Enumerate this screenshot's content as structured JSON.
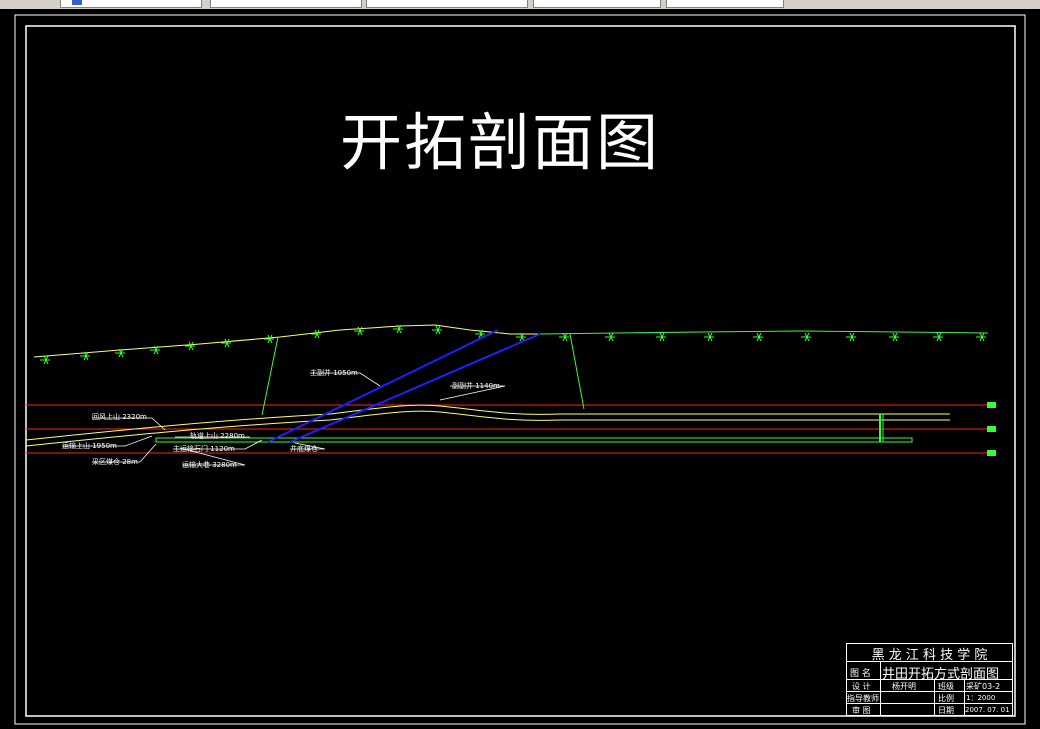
{
  "drawing": {
    "title": "开拓剖面图",
    "colors": {
      "background": "#000000",
      "border": "#ffffff",
      "surface": "#33ff33",
      "seam": "#ffff66",
      "shaft": "#1f1fff",
      "level": "#ff2020",
      "roadway": "#33ff33"
    },
    "labels": {
      "main_shaft": "主副井 1050m",
      "aux_shaft": "副副井 1140m",
      "return_uphill": "回风上山 2320m",
      "track_uphill": "轨道上山 2280m",
      "haul_uphill": "运输上山 1950m",
      "main_crosscut": "主运输石门 1120m",
      "mining_bunker": "采区煤仓 28m",
      "haul_roadway": "运输大巷 3280m",
      "shaft_bunker": "井底煤仓"
    }
  },
  "title_block": {
    "institution": "黑 龙 江 科 技 学 院",
    "drawing_name_label": "图 名",
    "drawing_name": "井田开拓方式剖面图",
    "design_label": "设 计",
    "designer": "杨开明",
    "class_label": "班级",
    "class_value": "采矿03-2",
    "advisor_label": "指导教师",
    "advisor": "",
    "scale_label": "比例",
    "scale_value": "1：2000",
    "review_label": "审 图",
    "reviewer": "",
    "date_label": "日期",
    "date_value": "2007. 07. 01"
  }
}
